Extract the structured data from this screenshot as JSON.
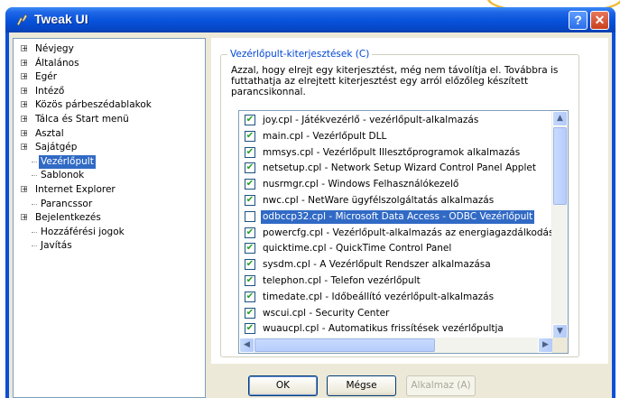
{
  "window": {
    "title": "Tweak UI",
    "help_glyph": "?",
    "close_glyph": "✕"
  },
  "tree": {
    "items": [
      {
        "label": "Névjegy",
        "expandable": true
      },
      {
        "label": "Általános",
        "expandable": true
      },
      {
        "label": "Egér",
        "expandable": true
      },
      {
        "label": "Intéző",
        "expandable": true
      },
      {
        "label": "Közös párbeszédablakok",
        "expandable": true
      },
      {
        "label": "Tálca és Start menü",
        "expandable": true
      },
      {
        "label": "Asztal",
        "expandable": true
      },
      {
        "label": "Sajátgép",
        "expandable": true
      },
      {
        "label": "Vezérlőpult",
        "expandable": false,
        "selected": true
      },
      {
        "label": "Sablonok",
        "expandable": false
      },
      {
        "label": "Internet Explorer",
        "expandable": true
      },
      {
        "label": "Parancssor",
        "expandable": false
      },
      {
        "label": "Bejelentkezés",
        "expandable": true
      },
      {
        "label": "Hozzáférési jogok",
        "expandable": false
      },
      {
        "label": "Javítás",
        "expandable": false
      }
    ]
  },
  "panel": {
    "group_title": "Vezérlőpult-kiterjesztések (C)",
    "description": "Azzal, hogy elrejt egy kiterjesztést, még nem távolítja el. Továbbra is futtathatja az elrejtett kiterjesztést egy arról előzőleg készített parancsikonnal.",
    "items": [
      {
        "label": "joy.cpl - Játékvezérlő - vezérlőpult-alkalmazás",
        "checked": true
      },
      {
        "label": "main.cpl - Vezérlőpult DLL",
        "checked": true
      },
      {
        "label": "mmsys.cpl - Vezérlőpult Illesztőprogramok alkalmazás",
        "checked": true
      },
      {
        "label": "netsetup.cpl - Network Setup Wizard Control Panel Applet",
        "checked": true
      },
      {
        "label": "nusrmgr.cpl - Windows Felhasználókezelő",
        "checked": true
      },
      {
        "label": "nwc.cpl - NetWare ügyfélszolgáltatás alkalmazás",
        "checked": true
      },
      {
        "label": "odbccp32.cpl - Microsoft Data Access - ODBC Vezérlőpult",
        "checked": false,
        "selected": true
      },
      {
        "label": "powercfg.cpl - Vezérlőpult-alkalmazás az energiagazdálkodás kon",
        "checked": true
      },
      {
        "label": "quicktime.cpl - QuickTime Control Panel",
        "checked": true
      },
      {
        "label": "sysdm.cpl - A Vezérlőpult Rendszer alkalmazása",
        "checked": true
      },
      {
        "label": "telephon.cpl - Telefon vezérlőpult",
        "checked": true
      },
      {
        "label": "timedate.cpl - Időbeállító vezérlőpult-alkalmazás",
        "checked": true
      },
      {
        "label": "wscui.cpl - Security Center",
        "checked": true
      },
      {
        "label": "wuaucpl.cpl - Automatikus frissítések vezérlőpultja",
        "checked": true
      }
    ]
  },
  "buttons": {
    "ok": "OK",
    "cancel": "Mégse",
    "apply": "Alkalmaz (A)"
  },
  "icons": {
    "check": "✔",
    "expand": "+",
    "scroll_up": "▲",
    "scroll_down": "▼",
    "scroll_left": "◀",
    "scroll_right": "▶"
  },
  "colors": {
    "titlebar": "#0752db",
    "selection": "#316ac5",
    "group_title": "#0046d5"
  }
}
